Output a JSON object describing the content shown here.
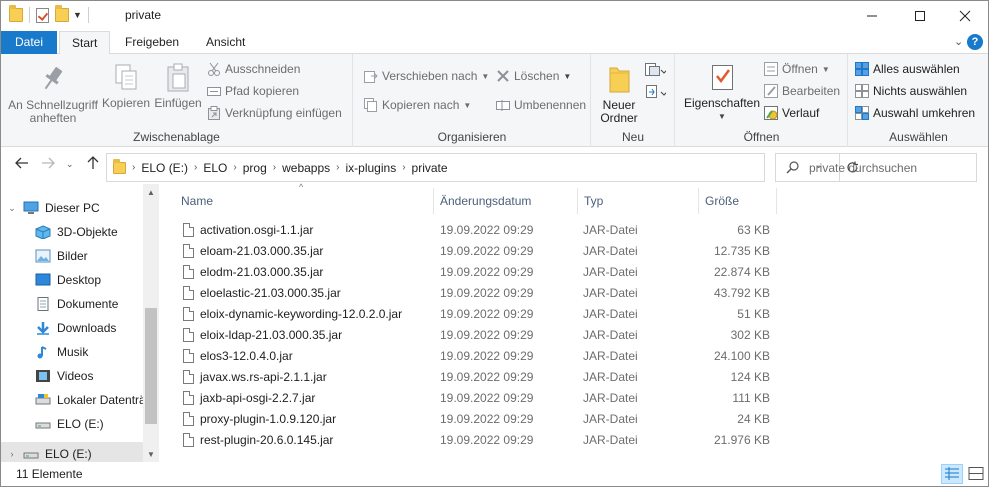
{
  "window": {
    "title": "private"
  },
  "ribbon": {
    "tabs": [
      {
        "label": "Datei"
      },
      {
        "label": "Start"
      },
      {
        "label": "Freigeben"
      },
      {
        "label": "Ansicht"
      }
    ],
    "groups": {
      "clipboard": {
        "label": "Zwischenablage",
        "pin_label_1": "An Schnellzugriff",
        "pin_label_2": "anheften",
        "copy": "Kopieren",
        "paste": "Einfügen",
        "cut": "Ausschneiden",
        "copy_path": "Pfad kopieren",
        "paste_shortcut": "Verknüpfung einfügen"
      },
      "organize": {
        "label": "Organisieren",
        "move_to": "Verschieben nach",
        "copy_to": "Kopieren nach",
        "delete": "Löschen",
        "rename": "Umbenennen"
      },
      "new": {
        "label": "Neu",
        "new_folder_1": "Neuer",
        "new_folder_2": "Ordner"
      },
      "open": {
        "label": "Öffnen",
        "properties": "Eigenschaften",
        "open": "Öffnen",
        "edit": "Bearbeiten",
        "history": "Verlauf"
      },
      "select": {
        "label": "Auswählen",
        "select_all": "Alles auswählen",
        "select_none": "Nichts auswählen",
        "invert": "Auswahl umkehren"
      }
    }
  },
  "address": {
    "crumbs": [
      "ELO (E:)",
      "ELO",
      "prog",
      "webapps",
      "ix-plugins",
      "private"
    ],
    "search_placeholder": "private durchsuchen"
  },
  "nav": {
    "items": [
      {
        "label": "Dieser PC",
        "icon": "pc-icon"
      },
      {
        "label": "3D-Objekte",
        "icon": "3d-objects-icon"
      },
      {
        "label": "Bilder",
        "icon": "pictures-icon"
      },
      {
        "label": "Desktop",
        "icon": "desktop-icon"
      },
      {
        "label": "Dokumente",
        "icon": "documents-icon"
      },
      {
        "label": "Downloads",
        "icon": "downloads-icon"
      },
      {
        "label": "Musik",
        "icon": "music-icon"
      },
      {
        "label": "Videos",
        "icon": "videos-icon"
      },
      {
        "label": "Lokaler Datenträ",
        "icon": "drive-icon"
      },
      {
        "label": "ELO (E:)",
        "icon": "drive-icon"
      },
      {
        "label": "ELO (E:)",
        "icon": "drive-icon"
      }
    ]
  },
  "list": {
    "columns": [
      "Name",
      "Änderungsdatum",
      "Typ",
      "Größe"
    ],
    "rows": [
      {
        "name": "activation.osgi-1.1.jar",
        "date": "19.09.2022 09:29",
        "type": "JAR-Datei",
        "size": "63 KB"
      },
      {
        "name": "eloam-21.03.000.35.jar",
        "date": "19.09.2022 09:29",
        "type": "JAR-Datei",
        "size": "12.735 KB"
      },
      {
        "name": "elodm-21.03.000.35.jar",
        "date": "19.09.2022 09:29",
        "type": "JAR-Datei",
        "size": "22.874 KB"
      },
      {
        "name": "eloelastic-21.03.000.35.jar",
        "date": "19.09.2022 09:29",
        "type": "JAR-Datei",
        "size": "43.792 KB"
      },
      {
        "name": "eloix-dynamic-keywording-12.0.2.0.jar",
        "date": "19.09.2022 09:29",
        "type": "JAR-Datei",
        "size": "51 KB"
      },
      {
        "name": "eloix-ldap-21.03.000.35.jar",
        "date": "19.09.2022 09:29",
        "type": "JAR-Datei",
        "size": "302 KB"
      },
      {
        "name": "elos3-12.0.4.0.jar",
        "date": "19.09.2022 09:29",
        "type": "JAR-Datei",
        "size": "24.100 KB"
      },
      {
        "name": "javax.ws.rs-api-2.1.1.jar",
        "date": "19.09.2022 09:29",
        "type": "JAR-Datei",
        "size": "124 KB"
      },
      {
        "name": "jaxb-api-osgi-2.2.7.jar",
        "date": "19.09.2022 09:29",
        "type": "JAR-Datei",
        "size": "111 KB"
      },
      {
        "name": "proxy-plugin-1.0.9.120.jar",
        "date": "19.09.2022 09:29",
        "type": "JAR-Datei",
        "size": "24 KB"
      },
      {
        "name": "rest-plugin-20.6.0.145.jar",
        "date": "19.09.2022 09:29",
        "type": "JAR-Datei",
        "size": "21.976 KB"
      }
    ]
  },
  "status": {
    "count": "11 Elemente"
  },
  "colors": {
    "accent": "#1979ca",
    "selection": "#cce8ff",
    "folder": "#f8cf55"
  }
}
